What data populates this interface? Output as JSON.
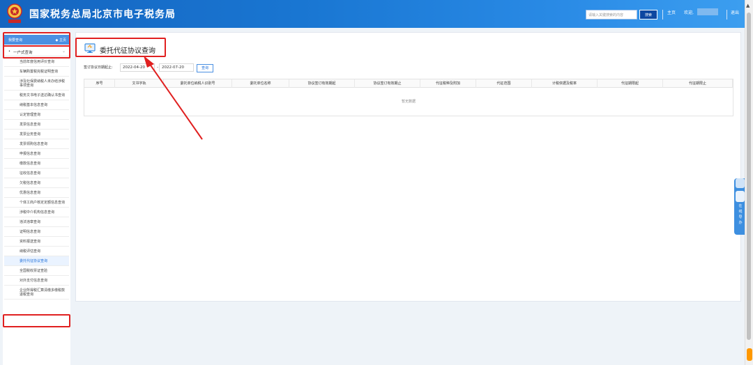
{
  "header": {
    "title": "国家税务总局北京市电子税务局",
    "search_placeholder": "请输入关键搜索的内容",
    "search_button": "搜索",
    "home_link": "主页",
    "welcome": "欢迎,",
    "logout": "退出",
    "colors": {
      "bar": "#1976d2",
      "accent": "#0d47a1"
    }
  },
  "sidebar": {
    "top_label": "我要查询",
    "home_label": "主页",
    "group_label": "一户式查询",
    "items": [
      {
        "label": "当前年度信用评价查询"
      },
      {
        "label": "车辆购置税完税证明查询"
      },
      {
        "label": "涉及社保费纳税人未办结涉税事项查询"
      },
      {
        "label": "税务文书电子送达确认书查询"
      },
      {
        "label": "纳税基本信息查询"
      },
      {
        "label": "认定管理查询"
      },
      {
        "label": "发票信息查询"
      },
      {
        "label": "发票业务查询"
      },
      {
        "label": "发票领购信息查询"
      },
      {
        "label": "申报信息查询"
      },
      {
        "label": "缴款信息查询"
      },
      {
        "label": "征收信息查询"
      },
      {
        "label": "欠税信息查询"
      },
      {
        "label": "优惠信息查询"
      },
      {
        "label": "个体工商户核定定额信息查询"
      },
      {
        "label": "涉税中介机构信息查询"
      },
      {
        "label": "违法违章查询"
      },
      {
        "label": "证明信息查询"
      },
      {
        "label": "资料报送查询"
      },
      {
        "label": "纳税评估查询"
      },
      {
        "label": "委托代征协议查询",
        "active": true
      },
      {
        "label": "全国税收票证查验"
      },
      {
        "label": "对外支付信息查询"
      },
      {
        "label": "企业所得税汇算清缴多缴税款退税查询"
      }
    ]
  },
  "main": {
    "page_title": "委托代征协议查询",
    "filter_label": "签订协议日期起止:",
    "date_from": "2022-04-20",
    "date_to": "2022-07-20",
    "date_separator": "-",
    "query_button": "查询",
    "table_headers": [
      "序号",
      "文书字轨",
      "委托单位纳税人识别号",
      "委托单位名称",
      "协议签订有效期起",
      "协议签订有效期止",
      "代征税种及附加",
      "代征范围",
      "计税依据及税率",
      "代征期限起",
      "代征期限止"
    ],
    "empty_text": "暂无数据"
  },
  "float_widget": {
    "label": "在线导办"
  }
}
